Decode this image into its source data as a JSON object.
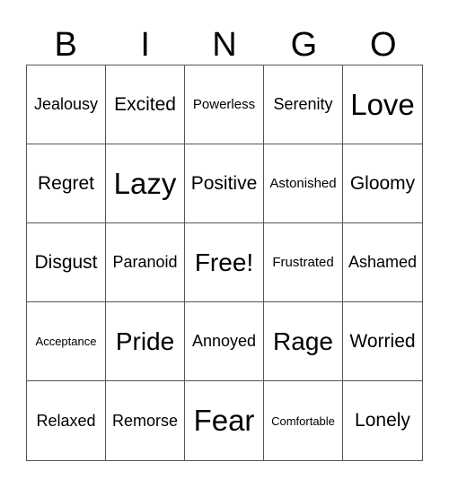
{
  "header": [
    "B",
    "I",
    "N",
    "G",
    "O"
  ],
  "cells": [
    {
      "text": "Jealousy",
      "size": 3
    },
    {
      "text": "Excited",
      "size": 4
    },
    {
      "text": "Powerless",
      "size": 2
    },
    {
      "text": "Serenity",
      "size": 3
    },
    {
      "text": "Love",
      "size": 6
    },
    {
      "text": "Regret",
      "size": 4
    },
    {
      "text": "Lazy",
      "size": 6
    },
    {
      "text": "Positive",
      "size": 4
    },
    {
      "text": "Astonished",
      "size": 2
    },
    {
      "text": "Gloomy",
      "size": 4
    },
    {
      "text": "Disgust",
      "size": 4
    },
    {
      "text": "Paranoid",
      "size": 3
    },
    {
      "text": "Free!",
      "size": 5
    },
    {
      "text": "Frustrated",
      "size": 2
    },
    {
      "text": "Ashamed",
      "size": 3
    },
    {
      "text": "Acceptance",
      "size": 1
    },
    {
      "text": "Pride",
      "size": 5
    },
    {
      "text": "Annoyed",
      "size": 3
    },
    {
      "text": "Rage",
      "size": 5
    },
    {
      "text": "Worried",
      "size": 4
    },
    {
      "text": "Relaxed",
      "size": 3
    },
    {
      "text": "Remorse",
      "size": 3
    },
    {
      "text": "Fear",
      "size": 6
    },
    {
      "text": "Comfortable",
      "size": 1
    },
    {
      "text": "Lonely",
      "size": 4
    }
  ]
}
